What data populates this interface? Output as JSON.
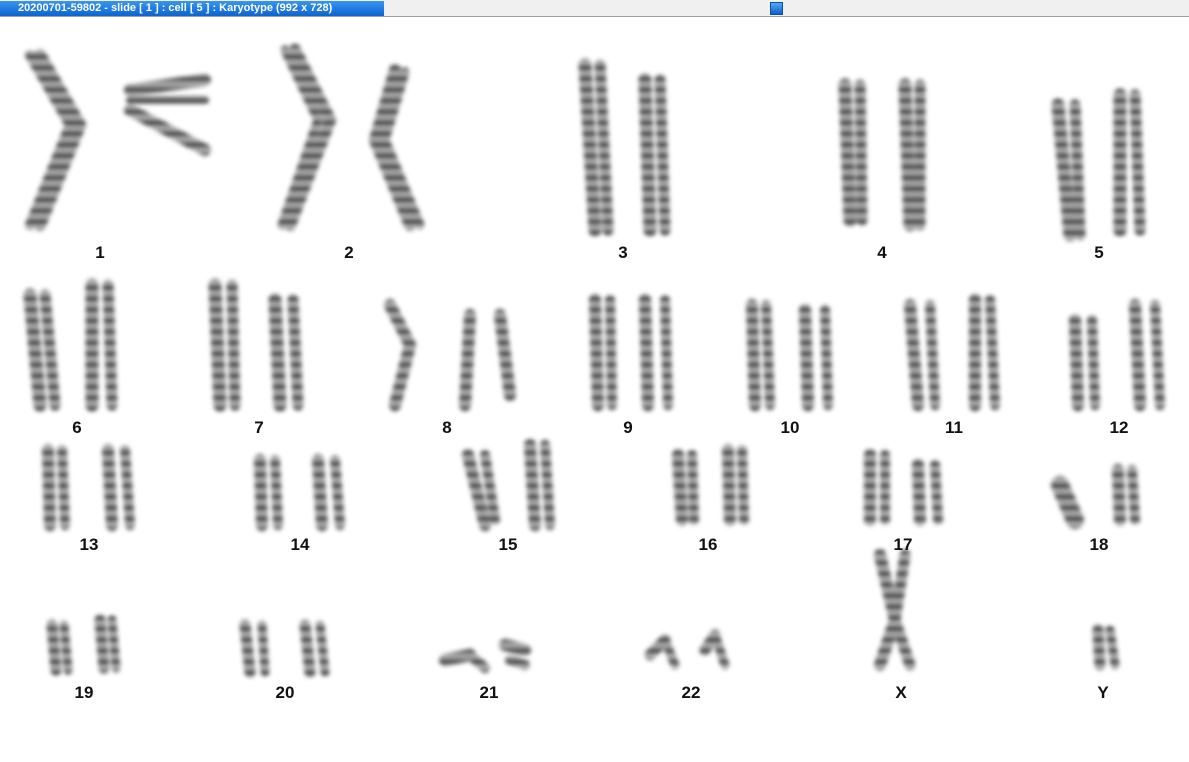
{
  "window": {
    "title": "20200701-59802 - slide [ 1 ] : cell [ 5 ] : Karyotype  (992 x 728)"
  },
  "karyotype": {
    "pairs": [
      {
        "label": "1"
      },
      {
        "label": "2"
      },
      {
        "label": "3"
      },
      {
        "label": "4"
      },
      {
        "label": "5"
      },
      {
        "label": "6"
      },
      {
        "label": "7"
      },
      {
        "label": "8"
      },
      {
        "label": "9"
      },
      {
        "label": "10"
      },
      {
        "label": "11"
      },
      {
        "label": "12"
      },
      {
        "label": "13"
      },
      {
        "label": "14"
      },
      {
        "label": "15"
      },
      {
        "label": "16"
      },
      {
        "label": "17"
      },
      {
        "label": "18"
      },
      {
        "label": "19"
      },
      {
        "label": "20"
      },
      {
        "label": "21"
      },
      {
        "label": "22"
      },
      {
        "label": "X"
      },
      {
        "label": "Y"
      }
    ]
  }
}
